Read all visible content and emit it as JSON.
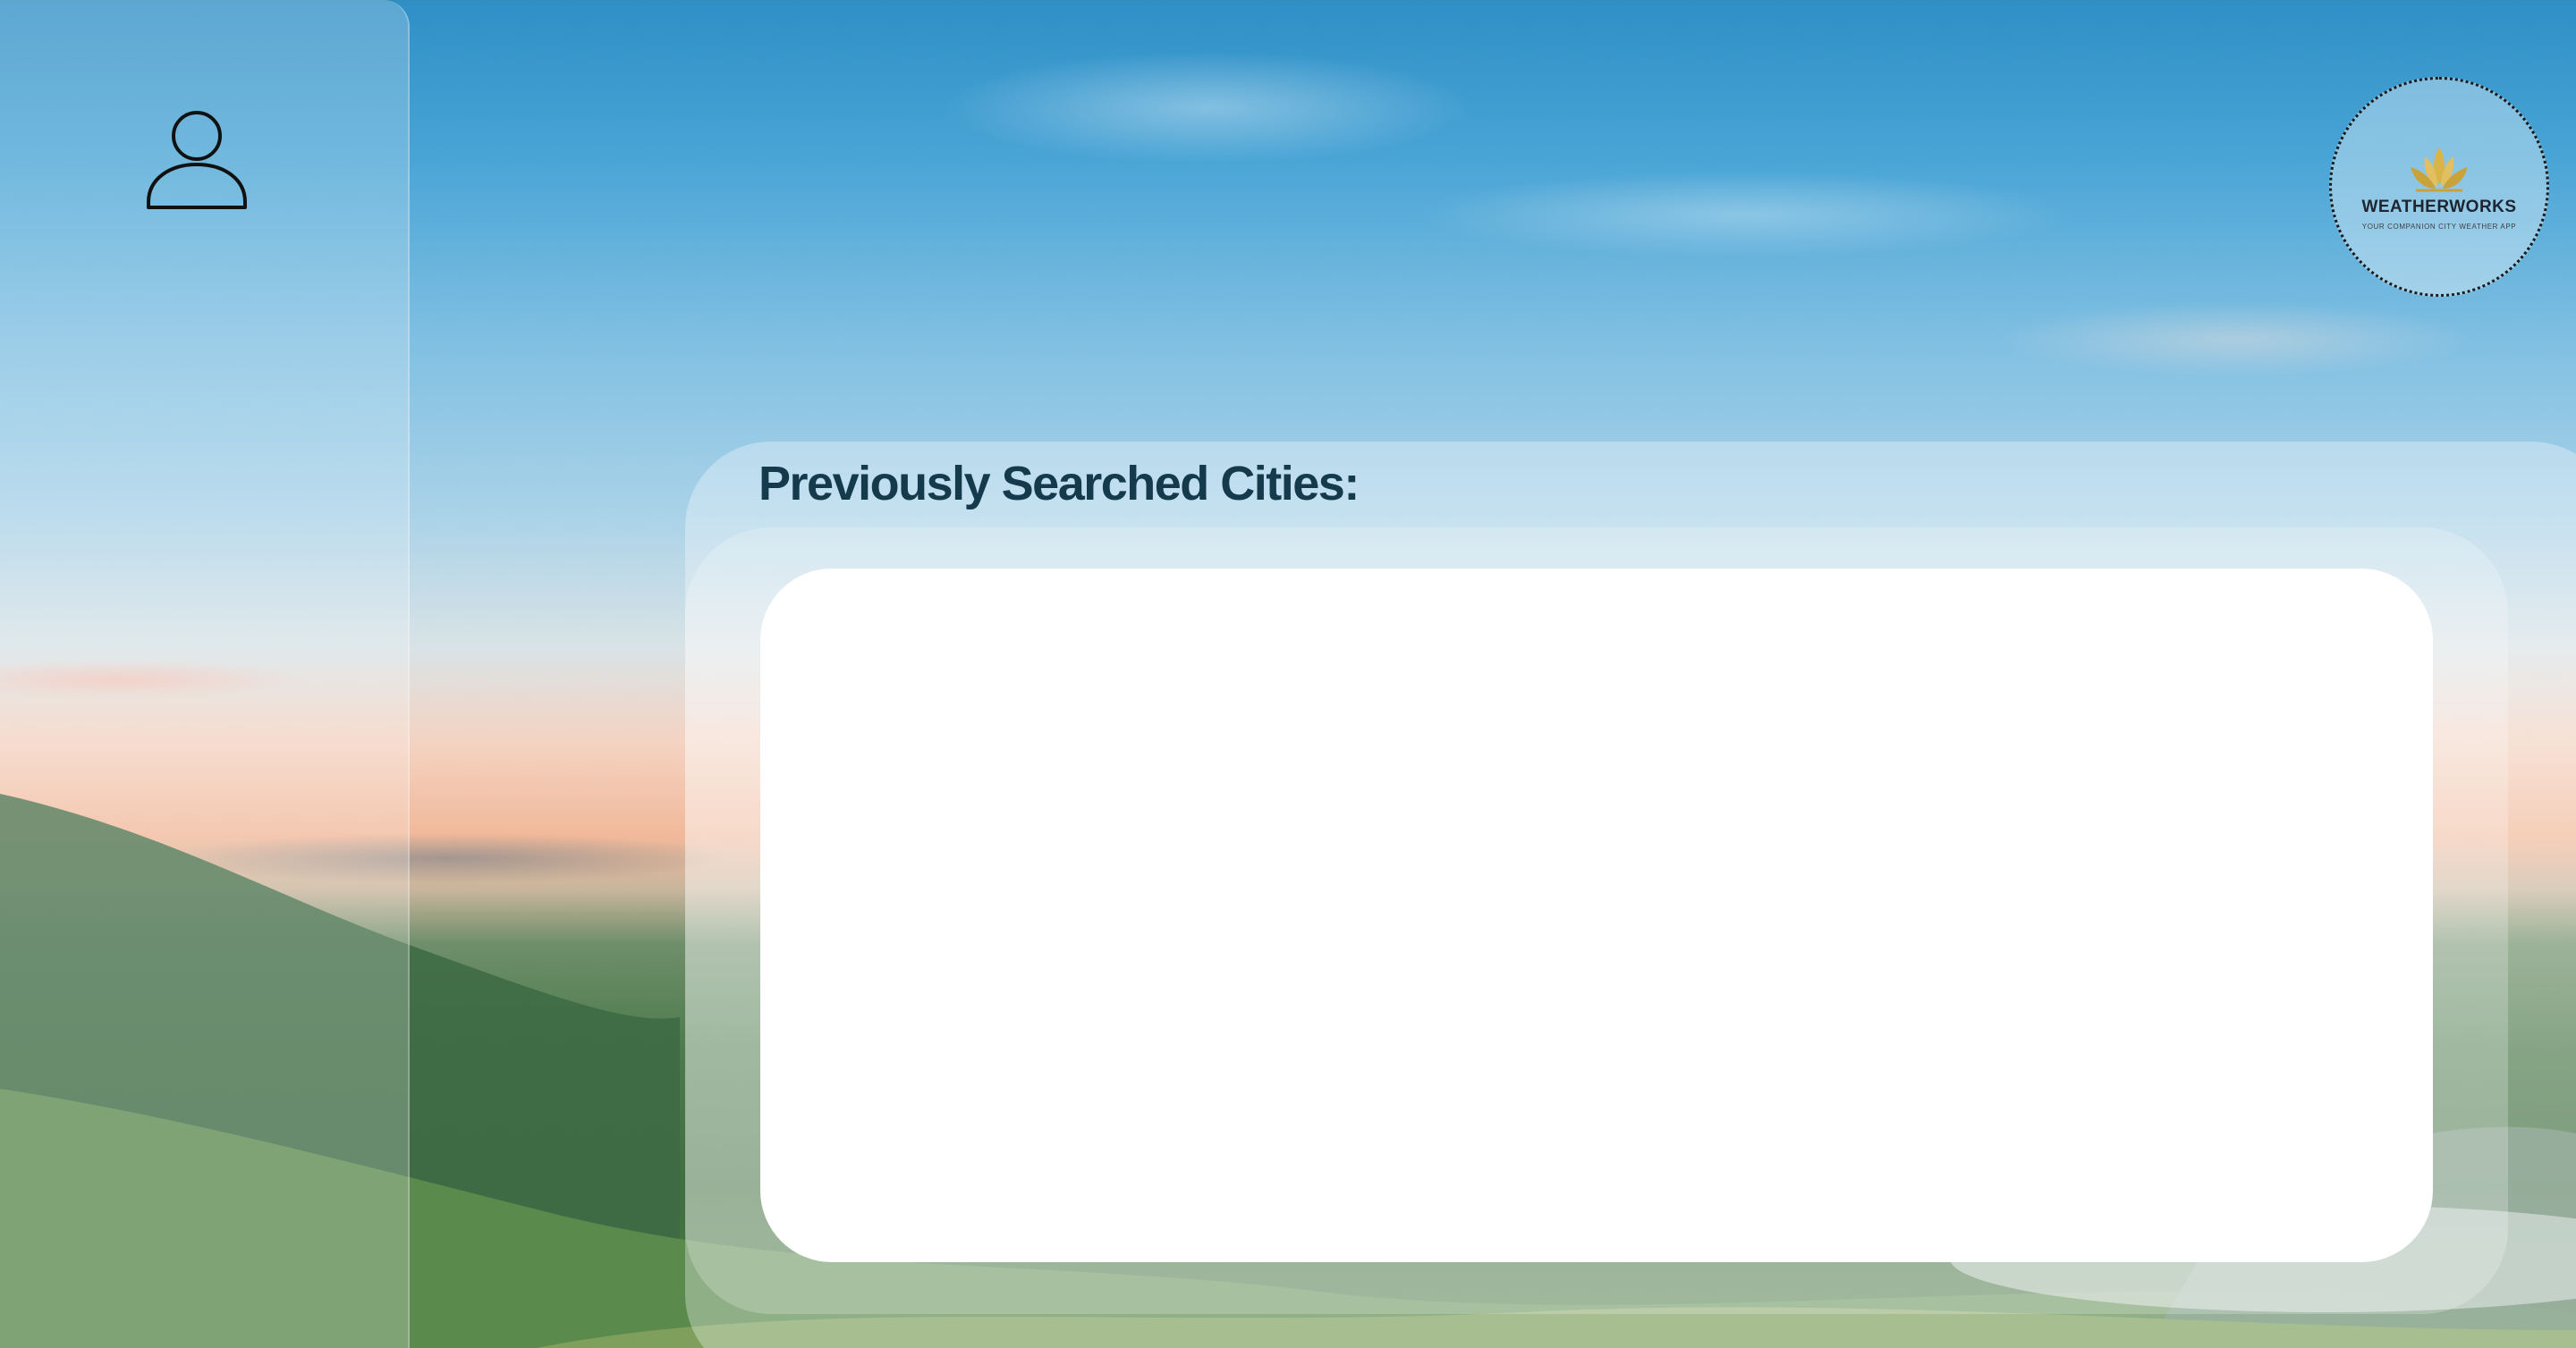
{
  "background": {
    "sky_top_color": "#2f8fc6",
    "horizon_color": "#f1b99a",
    "hill_color": "#4d7a4c"
  },
  "sidebar": {
    "user_icon": "user-icon"
  },
  "logo": {
    "icon": "lotus-icon",
    "title": "WEATHERWORKS",
    "tagline": "YOUR COMPANION CITY WEATHER APP"
  },
  "main": {
    "title": "Previously Searched Cities:",
    "cities": []
  },
  "colors": {
    "title_text": "#143a4c",
    "logo_gold": "#d9b446"
  }
}
